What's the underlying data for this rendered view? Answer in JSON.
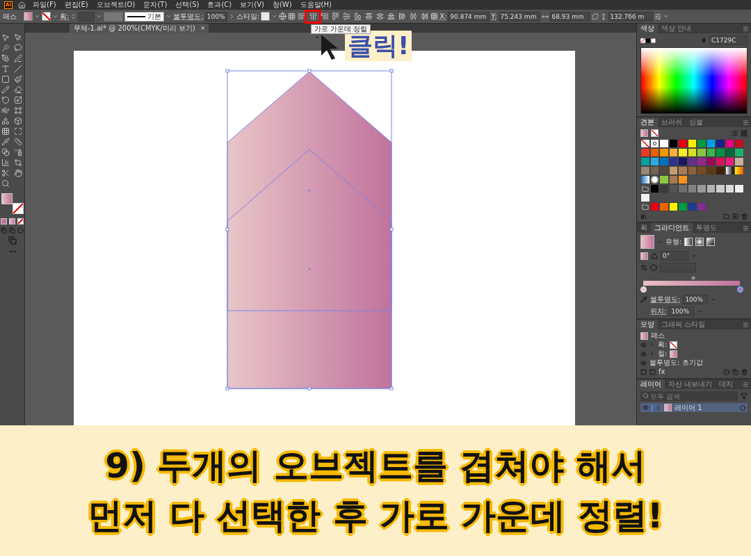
{
  "app": {
    "logo": "Ai"
  },
  "menu": [
    "파일(F)",
    "편집(E)",
    "오브젝트(O)",
    "문자(T)",
    "선택(S)",
    "효과(C)",
    "보기(V)",
    "창(W)",
    "도움말(H)"
  ],
  "control_bar": {
    "object_type": "패스",
    "stroke_label": "획:",
    "stroke_style": "기본",
    "opacity_label": "불투명도:",
    "opacity": "100%",
    "style_label": "스타일:",
    "align_buttons": [
      {
        "highlighted": false
      },
      {
        "highlighted": true,
        "tooltip": "가로 가운데 정렬"
      },
      {
        "highlighted": false
      },
      {
        "highlighted": false
      },
      {
        "highlighted": false
      },
      {
        "highlighted": false
      },
      {
        "highlighted": false
      },
      {
        "highlighted": false
      },
      {
        "highlighted": false
      },
      {
        "highlighted": false
      },
      {
        "highlighted": false
      },
      {
        "highlighted": false
      }
    ],
    "x_label": "X:",
    "x": "90.874 mm",
    "y_label": "Y:",
    "y": "75.243 mm",
    "width": "68.93 mm",
    "height": "132.766 m"
  },
  "document_tab": {
    "title": "무제-1.ai* @ 200%(CMYK/미리 보기)",
    "close": "×"
  },
  "annotation": {
    "label": "클릭!"
  },
  "color_panel": {
    "tabs": [
      {
        "label": "색상",
        "selected": true
      },
      {
        "label": "색상 안내",
        "selected": false
      }
    ],
    "hex": "C1729C"
  },
  "swatches_panel": {
    "tabs": [
      {
        "label": "견본",
        "selected": true
      },
      {
        "label": "브러쉬",
        "selected": false
      },
      {
        "label": "심볼",
        "selected": false
      }
    ],
    "rows": [
      [
        {
          "kind": "none"
        },
        {
          "kind": "registration"
        },
        {
          "kind": "color",
          "color": "#ffffff"
        },
        {
          "kind": "color",
          "color": "#000000"
        },
        {
          "kind": "color",
          "color": "#e60012"
        },
        {
          "kind": "color",
          "color": "#fff100"
        },
        {
          "kind": "color",
          "color": "#009944"
        },
        {
          "kind": "color",
          "color": "#00a0e9"
        },
        {
          "kind": "color",
          "color": "#1d2088"
        },
        {
          "kind": "color",
          "color": "#e4007f"
        },
        {
          "kind": "color",
          "color": "#c30d23"
        }
      ],
      [
        {
          "kind": "color",
          "color": "#e83828"
        },
        {
          "kind": "color",
          "color": "#eb6100"
        },
        {
          "kind": "color",
          "color": "#f39800"
        },
        {
          "kind": "color",
          "color": "#fbb03b"
        },
        {
          "kind": "color",
          "color": "#fcee21"
        },
        {
          "kind": "color",
          "color": "#d9e021"
        },
        {
          "kind": "color",
          "color": "#8cc63f"
        },
        {
          "kind": "color",
          "color": "#39b54a"
        },
        {
          "kind": "color",
          "color": "#009245"
        },
        {
          "kind": "color",
          "color": "#006837"
        },
        {
          "kind": "color",
          "color": "#1bb06b"
        }
      ],
      [
        {
          "kind": "color",
          "color": "#00a29a"
        },
        {
          "kind": "color",
          "color": "#29abe2"
        },
        {
          "kind": "color",
          "color": "#0071bc"
        },
        {
          "kind": "color",
          "color": "#2e3192"
        },
        {
          "kind": "color",
          "color": "#1b1464"
        },
        {
          "kind": "color",
          "color": "#662d91"
        },
        {
          "kind": "color",
          "color": "#93278f"
        },
        {
          "kind": "color",
          "color": "#9e005d"
        },
        {
          "kind": "color",
          "color": "#d4145a"
        },
        {
          "kind": "color",
          "color": "#ed1e79"
        },
        {
          "kind": "color",
          "color": "#c7b299"
        }
      ],
      [
        {
          "kind": "color",
          "color": "#998675"
        },
        {
          "kind": "color",
          "color": "#736357"
        },
        {
          "kind": "color",
          "color": "#534741"
        },
        {
          "kind": "color",
          "color": "#c69c6d"
        },
        {
          "kind": "color",
          "color": "#a67c52"
        },
        {
          "kind": "color",
          "color": "#8c6239"
        },
        {
          "kind": "color",
          "color": "#754c24"
        },
        {
          "kind": "color",
          "color": "#603813"
        },
        {
          "kind": "color",
          "color": "#42210b"
        },
        {
          "kind": "gradient_gray"
        },
        {
          "kind": "gradient_orange"
        }
      ],
      [
        {
          "kind": "gradient_blue"
        },
        {
          "kind": "radial"
        },
        {
          "kind": "pattern",
          "color": "#8cc63f"
        },
        {
          "kind": "pattern",
          "color": "#a67c52"
        },
        {
          "kind": "pattern",
          "color": "#f7931e"
        }
      ],
      [
        {
          "kind": "folder"
        },
        {
          "kind": "color",
          "color": "#000000"
        },
        {
          "kind": "color",
          "color": "#3e3a39"
        },
        {
          "kind": "color",
          "color": "#555555"
        },
        {
          "kind": "color",
          "color": "#6d6d6d"
        },
        {
          "kind": "color",
          "color": "#808080"
        },
        {
          "kind": "color",
          "color": "#999999"
        },
        {
          "kind": "color",
          "color": "#b3b3b3"
        },
        {
          "kind": "color",
          "color": "#cccccc"
        },
        {
          "kind": "color",
          "color": "#dcdcdc"
        },
        {
          "kind": "color",
          "color": "#efefef"
        }
      ],
      [
        {
          "kind": "color",
          "color": "#f2f2f2"
        }
      ],
      [
        {
          "kind": "folder"
        },
        {
          "kind": "color",
          "color": "#e60012"
        },
        {
          "kind": "color",
          "color": "#eb6100"
        },
        {
          "kind": "color",
          "color": "#fff100"
        },
        {
          "kind": "color",
          "color": "#009944"
        },
        {
          "kind": "color",
          "color": "#1d3b94"
        },
        {
          "kind": "color",
          "color": "#7d2e8f"
        }
      ]
    ]
  },
  "gradient_panel": {
    "tabs": [
      {
        "label": "획",
        "selected": false
      },
      {
        "label": "그라디언트",
        "selected": true
      },
      {
        "label": "투명도",
        "selected": false
      }
    ],
    "type_label": "유형:",
    "stops": [
      {
        "selected": false
      },
      {
        "selected": true
      }
    ],
    "angle": "0°",
    "opacity_label": "불투명도:",
    "opacity": "100%",
    "location_label": "위치:",
    "location": "100%"
  },
  "appearance_panel": {
    "tabs": [
      {
        "label": "모양",
        "selected": true
      },
      {
        "label": "그래픽 스타일",
        "selected": false
      }
    ],
    "object": "패스",
    "rows": [
      {
        "kind": "stroke",
        "label": "획:"
      },
      {
        "kind": "fill",
        "label": "칠:"
      }
    ],
    "opacity_row": "불투명도: 초기값",
    "effects_button": "fx"
  },
  "layers_panel": {
    "tabs": [
      {
        "label": "레이어",
        "selected": true
      },
      {
        "label": "자산 내보내기",
        "selected": false
      },
      {
        "label": "대지",
        "selected": false
      }
    ],
    "search_placeholder": "모두 검색",
    "layers": [
      {
        "name": "레이어 1",
        "selected": true
      }
    ]
  },
  "caption": {
    "lines": [
      "9) 두개의 오브젝트를 겹쳐야 해서",
      "먼저 다 선택한 후 가로 가운데 정렬!"
    ]
  }
}
